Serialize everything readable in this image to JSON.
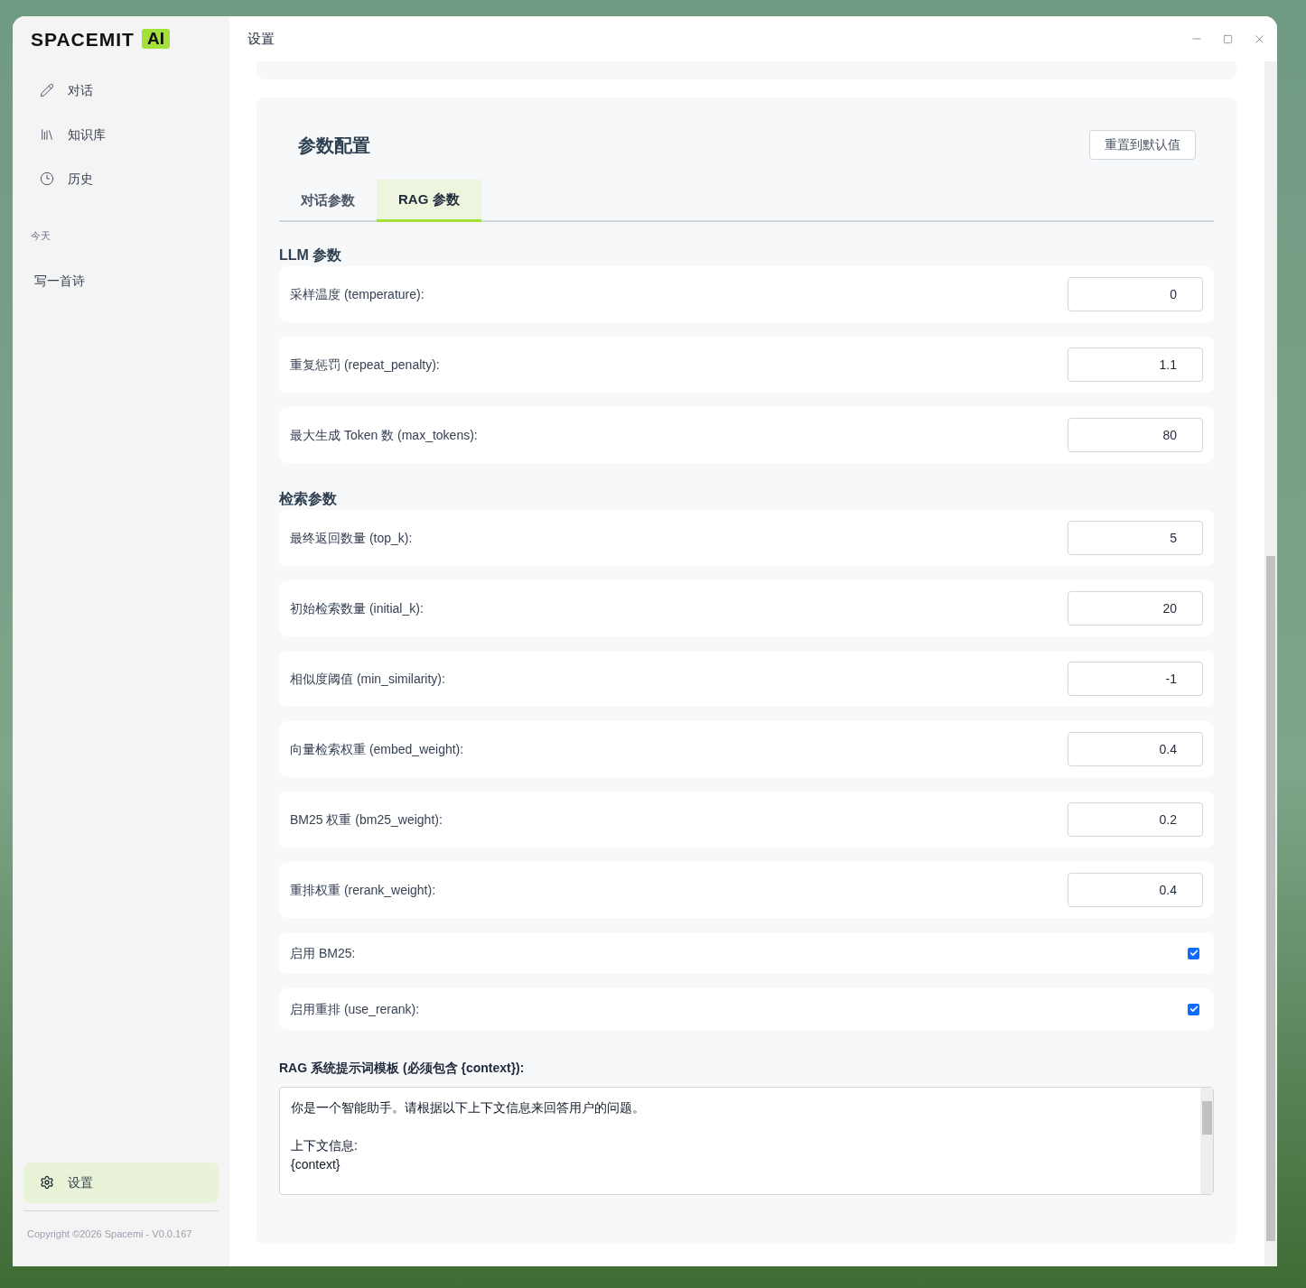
{
  "sidebar": {
    "logo": {
      "wordmark": "SPACEMIT",
      "badge": "AI"
    },
    "nav": [
      {
        "label": "对话",
        "kind": "pencil",
        "selected": false
      },
      {
        "label": "知识库",
        "kind": "books",
        "selected": false
      },
      {
        "label": "历史",
        "kind": "clock",
        "selected": false
      }
    ],
    "history_group": "今天",
    "history": [
      {
        "label": "写一首诗"
      }
    ],
    "settings": {
      "label": "设置",
      "selected": true
    },
    "copyright": "Copyright ©2026 Spacemi - V0.0.167"
  },
  "window": {
    "title": "设置"
  },
  "panel": {
    "title": "参数配置",
    "reset_button": "重置到默认值",
    "tabs": [
      {
        "label": "对话参数",
        "selected": false
      },
      {
        "label": "RAG 参数",
        "selected": true
      }
    ],
    "sections": [
      {
        "title": "LLM 参数",
        "rows": [
          {
            "kind": "number",
            "label": "采样温度 (temperature):",
            "value": "0"
          },
          {
            "kind": "number",
            "label": "重复惩罚 (repeat_penalty):",
            "value": "1.1"
          },
          {
            "kind": "number",
            "label": "最大生成 Token 数 (max_tokens):",
            "value": "80"
          }
        ]
      },
      {
        "title": "检索参数",
        "rows": [
          {
            "kind": "number",
            "label": "最终返回数量 (top_k):",
            "value": "5"
          },
          {
            "kind": "number",
            "label": "初始检索数量 (initial_k):",
            "value": "20"
          },
          {
            "kind": "number",
            "label": "相似度阈值 (min_similarity):",
            "value": "-1"
          },
          {
            "kind": "number",
            "label": "向量检索权重 (embed_weight):",
            "value": "0.4"
          },
          {
            "kind": "number",
            "label": "BM25 权重 (bm25_weight):",
            "value": "0.2"
          },
          {
            "kind": "number",
            "label": "重排权重 (rerank_weight):",
            "value": "0.4"
          },
          {
            "kind": "checkbox",
            "label": "启用 BM25:",
            "checked": true
          },
          {
            "kind": "checkbox",
            "label": "启用重排 (use_rerank):",
            "checked": true
          }
        ]
      }
    ],
    "prompt": {
      "label": "RAG 系统提示词模板 (必须包含 {context}):",
      "paragraphs": [
        [
          "你是一个智能助手。请根据以下上下文信息来回答用户的问题。"
        ],
        [
          "上下文信息:",
          "{context}"
        ]
      ]
    }
  }
}
